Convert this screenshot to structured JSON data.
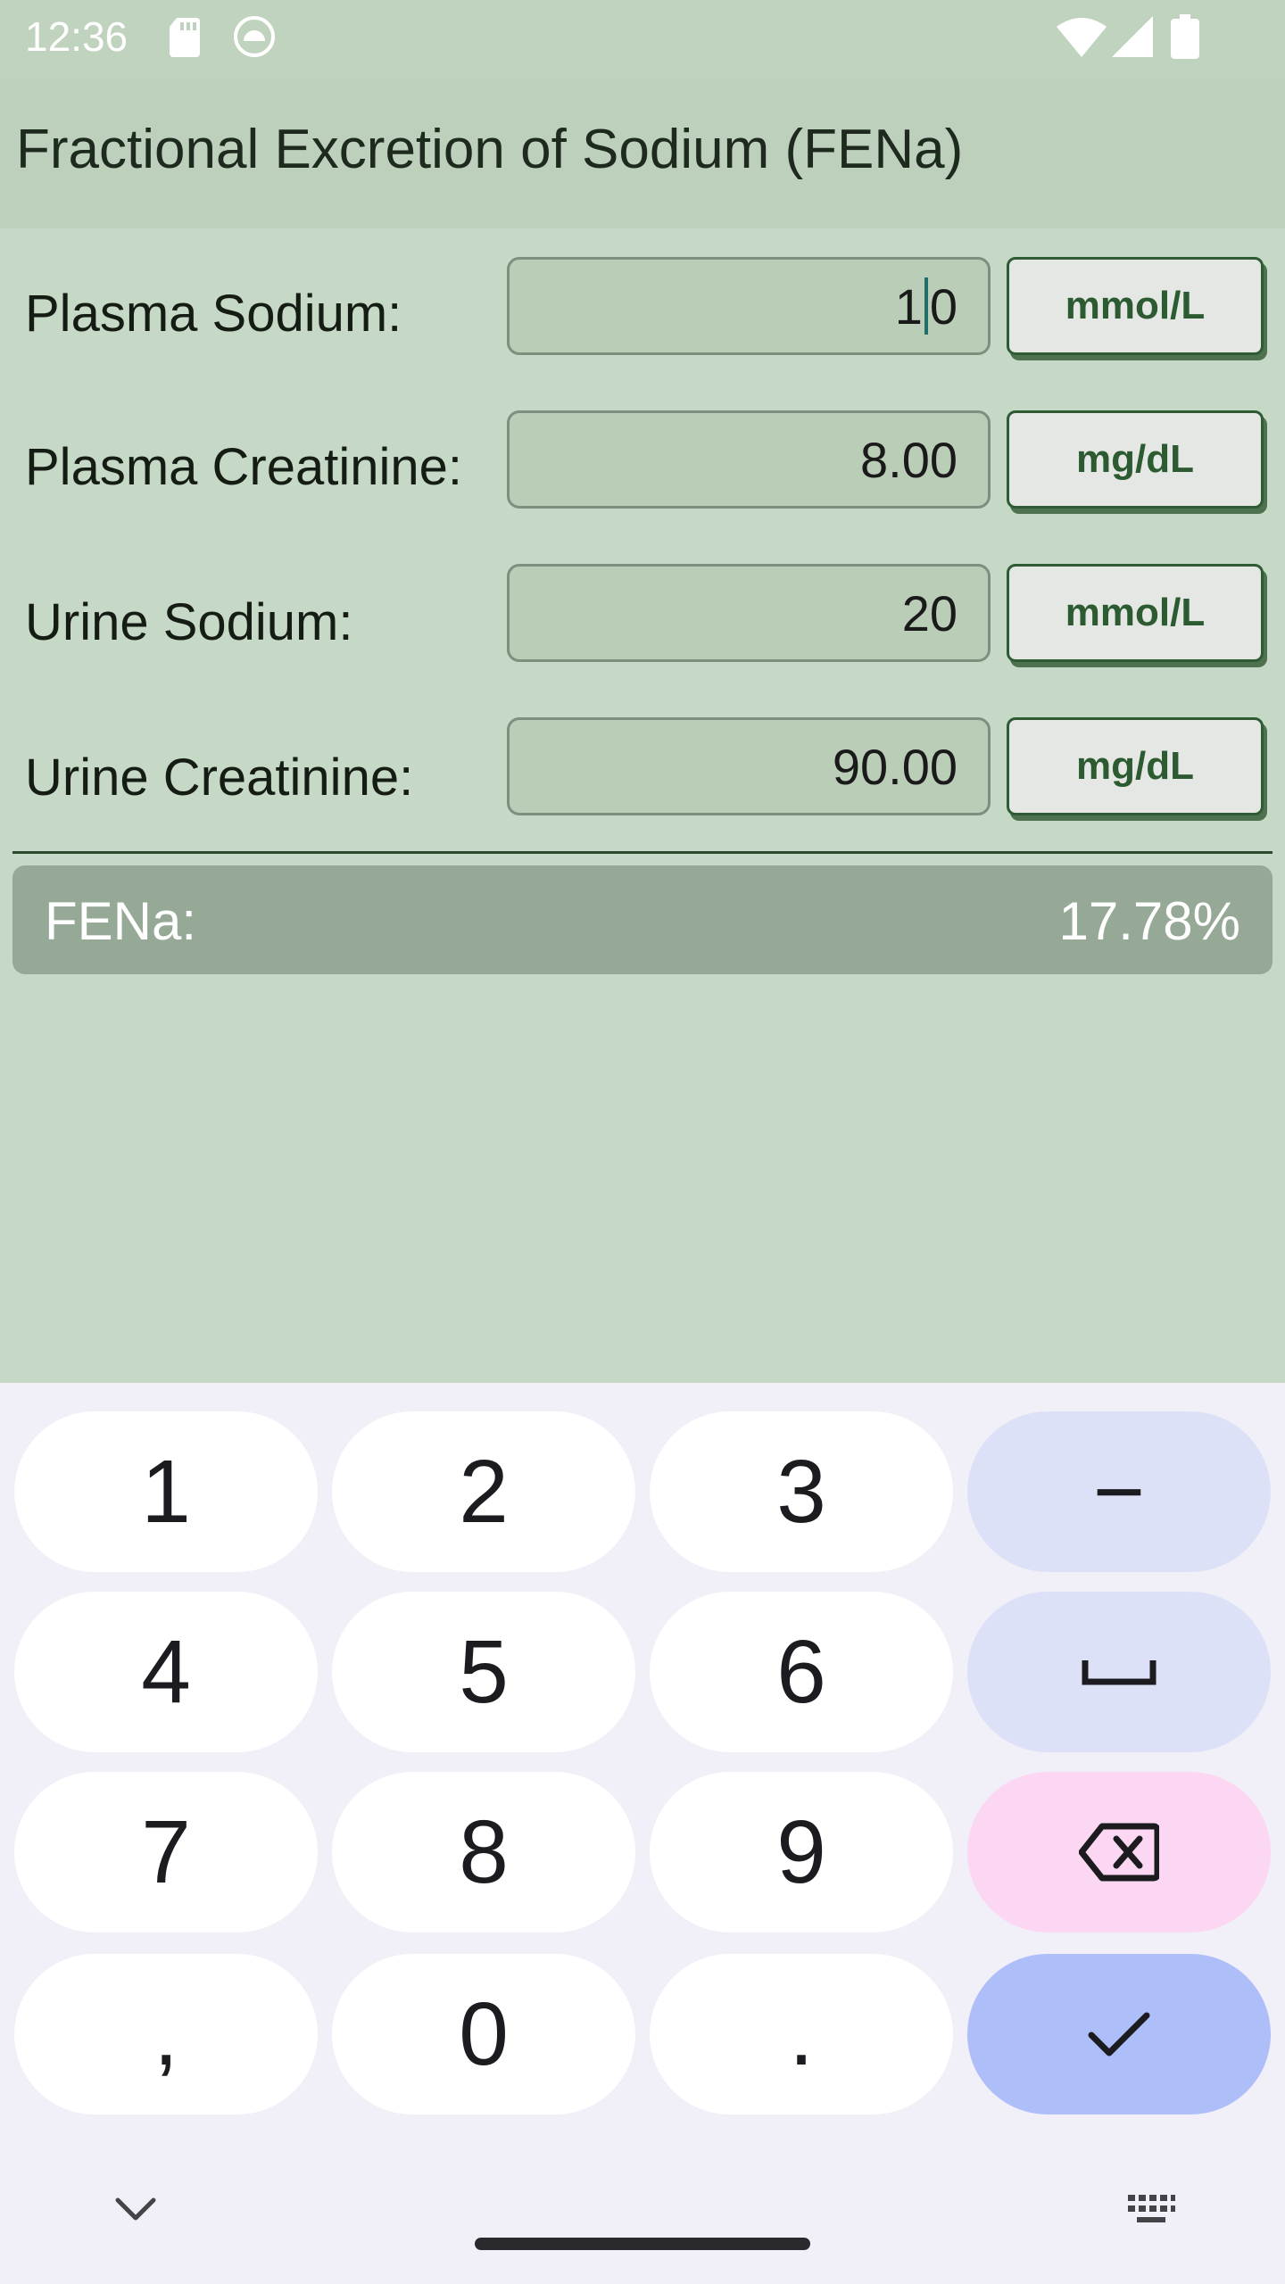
{
  "status_bar": {
    "time": "12:36"
  },
  "app": {
    "title": "Fractional Excretion of Sodium (FENa)"
  },
  "form": {
    "rows": [
      {
        "label": "Plasma Sodium:",
        "value_before_caret": "1",
        "value_after_caret": "0",
        "unit": "mmol/L"
      },
      {
        "label": "Plasma Creatinine:",
        "value": "8.00",
        "unit": "mg/dL"
      },
      {
        "label": "Urine Sodium:",
        "value": "20",
        "unit": "mmol/L"
      },
      {
        "label": "Urine Creatinine:",
        "value": "90.00",
        "unit": "mg/dL"
      }
    ]
  },
  "result": {
    "label": "FENa:",
    "value": "17.78%"
  },
  "keyboard": {
    "keys": [
      "1",
      "2",
      "3",
      "−",
      "4",
      "5",
      "6",
      "␣",
      "7",
      "8",
      "9",
      "⌫",
      ",",
      "0",
      ".",
      "✓"
    ]
  },
  "colors": {
    "background": "#c6d8c6",
    "app_bar": "#bcd0bc",
    "accent": "#2d5b31",
    "result_bar": "#96a996",
    "key_done": "#aebef8",
    "key_delete": "#fbd7f3",
    "key_function": "#dde1f7"
  }
}
